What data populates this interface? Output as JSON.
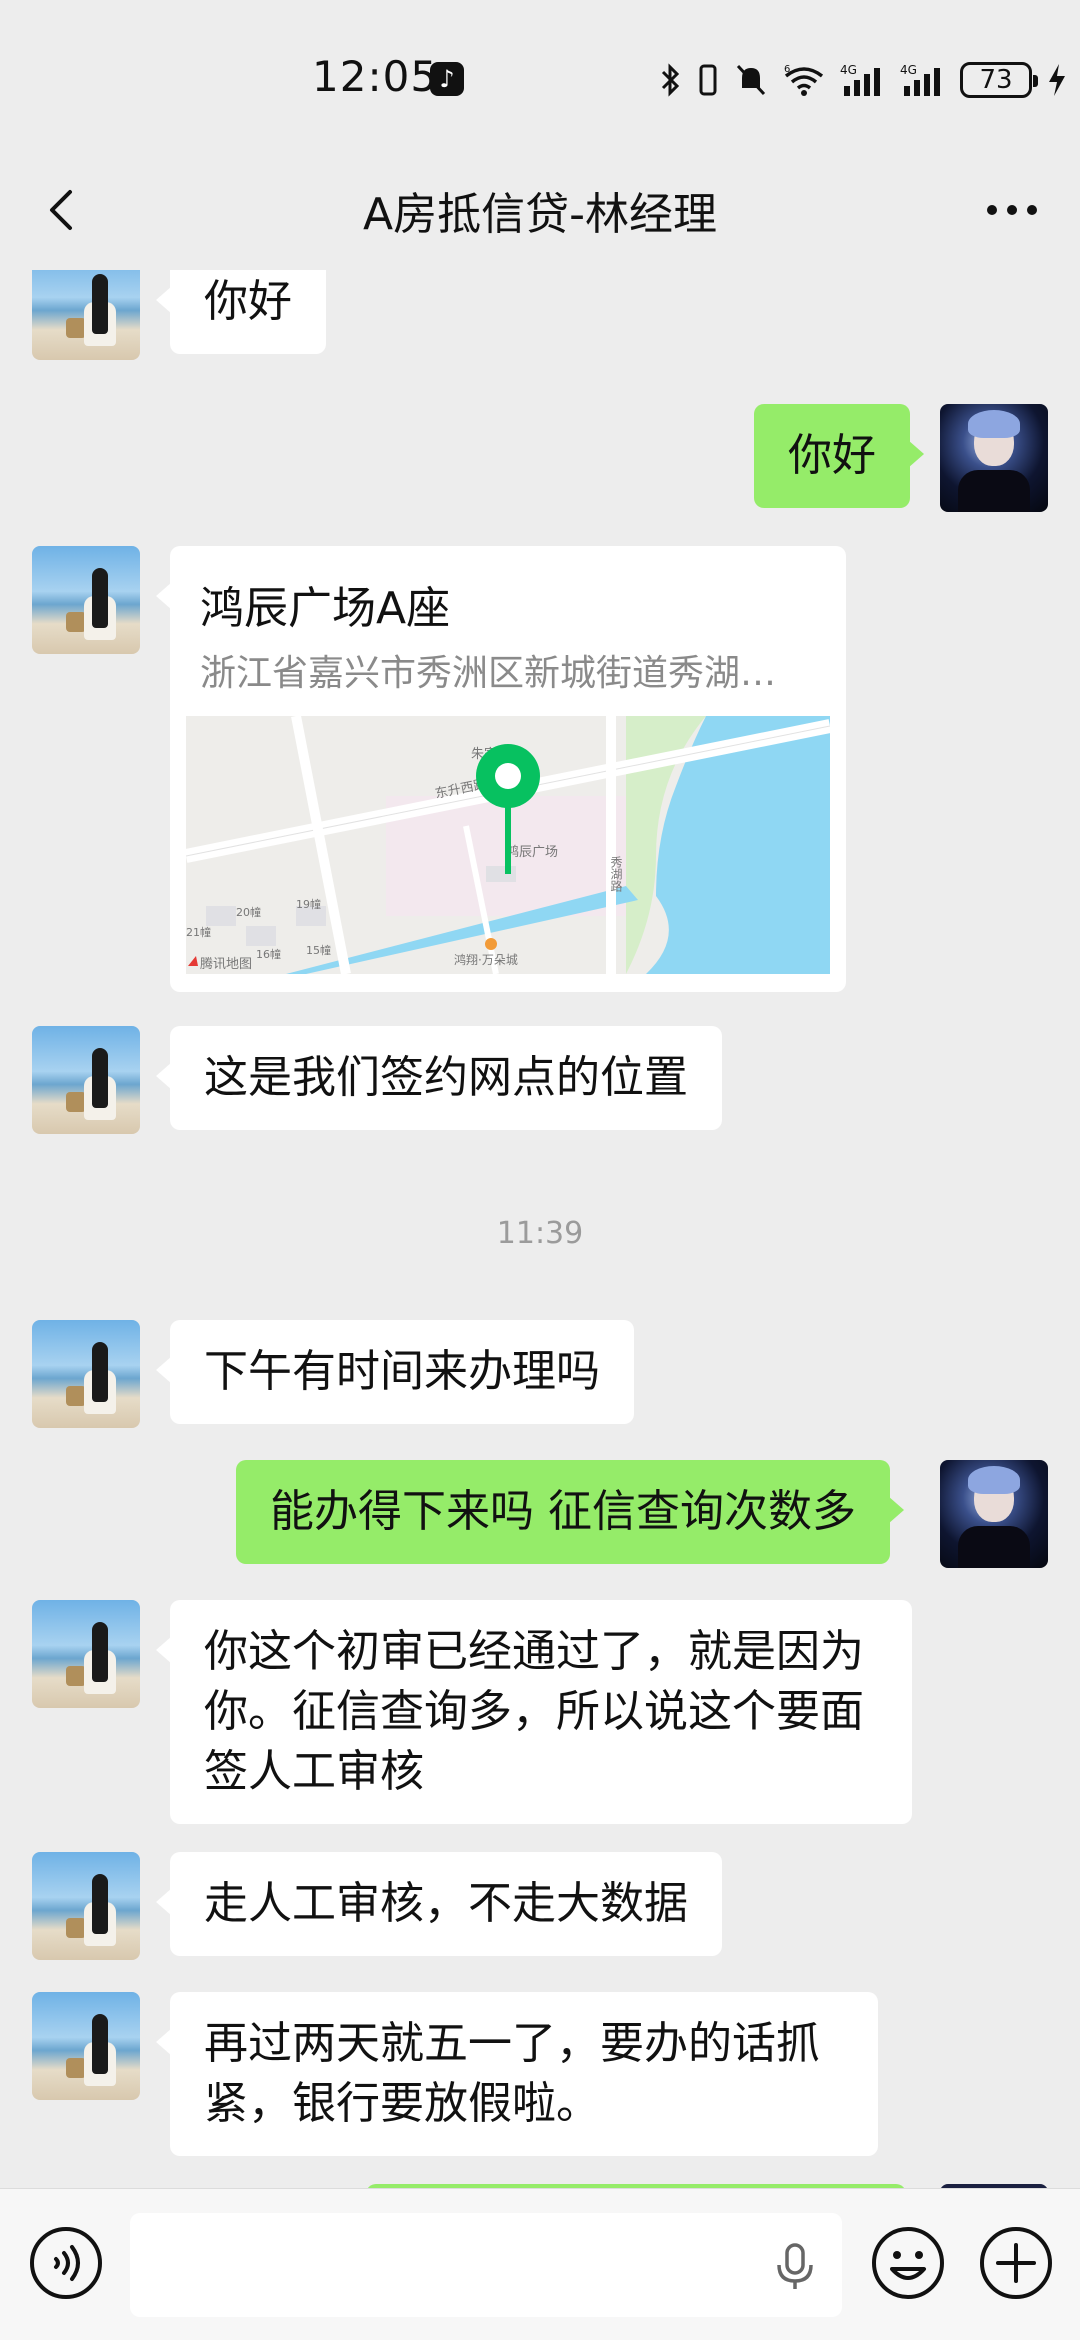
{
  "status_bar": {
    "time": "12:05",
    "battery": "73",
    "network_1": "4G",
    "network_2": "4G",
    "wifi_label": "6"
  },
  "header": {
    "title": "A房抵信贷-林经理"
  },
  "messages": [
    {
      "side": "left",
      "text": "你好"
    },
    {
      "side": "right",
      "text": "你好"
    },
    {
      "side": "left",
      "type": "location",
      "name": "鸿辰广场A座",
      "address": "浙江省嘉兴市秀洲区新城街道秀湖…"
    },
    {
      "side": "left",
      "text": "这是我们签约网点的位置"
    },
    {
      "side": "left",
      "text": "下午有时间来办理吗"
    },
    {
      "side": "right",
      "text": "能办得下来吗 征信查询次数多"
    },
    {
      "side": "left",
      "text": "你这个初审已经通过了，就是因为你。征信查询多，所以说这个要面签人工审核"
    },
    {
      "side": "left",
      "text": "走人工审核，不走大数据"
    },
    {
      "side": "left",
      "text": "再过两天就五一了，要办的话抓紧，银行要放假啦。"
    }
  ],
  "timestamp": "11:39",
  "map": {
    "labels": [
      "朱家桥",
      "东升西路",
      "鸿辰广场",
      "秀湖路",
      "鸿翔·万朵城",
      "21幢",
      "20幢",
      "19幢",
      "16幢",
      "15幢"
    ],
    "brand": "腾讯地图",
    "pin_color": "#07C160",
    "water_color": "#8FD7F3",
    "park_color": "#D6EEC9"
  },
  "input": {
    "placeholder": ""
  },
  "colors": {
    "sent_bubble": "#95EC69",
    "received_bubble": "#FFFFFF",
    "background": "#EDEDED"
  }
}
